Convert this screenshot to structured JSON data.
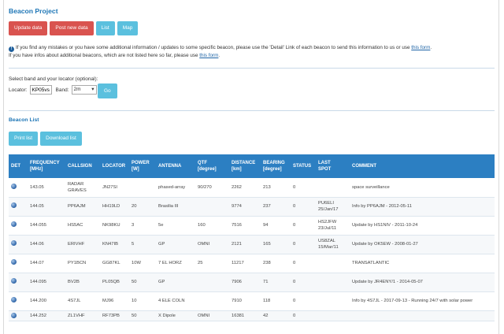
{
  "title": "Beacon Project",
  "buttons": {
    "update": "Update data",
    "post": "Post new data",
    "list": "List",
    "map": "Map"
  },
  "info": {
    "line1_pre": "If you find any mistakes or you have some additional information / updates to some specific beacon, please use the 'Detail' Link of each beacon to send this information to us or use ",
    "line1_link": "this form",
    "line1_post": ".",
    "line2_pre": "If you have infos about additional beacons, which are not listed here so far, please use ",
    "line2_link": "this form",
    "line2_post": "."
  },
  "selector": {
    "label": "Select band and your locator (optional):",
    "locator_label": "Locator:",
    "locator_value": "KP05vs",
    "band_label": "Band:",
    "band_value": "2m",
    "go": "Go"
  },
  "beacon_list": {
    "title": "Beacon List",
    "print": "Print list",
    "download": "Download list"
  },
  "table": {
    "headers": {
      "det": "DET",
      "freq": [
        "FREQUENCY",
        "[MHz]"
      ],
      "callsign": "CALLSIGN",
      "locator": "LOCATOR",
      "power": [
        "POWER",
        "[W]"
      ],
      "antenna": "ANTENNA",
      "qtf": [
        "QTF",
        "[degree]"
      ],
      "distance": [
        "DISTANCE",
        "[km]"
      ],
      "bearing": [
        "BEARING",
        "[degree]"
      ],
      "status": "STATUS",
      "lastspot": [
        "LAST",
        "SPOT"
      ],
      "comment": "COMMENT"
    },
    "rows": [
      {
        "freq": "143.05",
        "callsign": [
          "RADAR",
          "GRAVES"
        ],
        "locator": "JN27SI",
        "power": "",
        "antenna": "phased-array",
        "qtf": "90/270",
        "distance": "2262",
        "bearing": "213",
        "status": "0",
        "lastspot": [
          "",
          ""
        ],
        "comment": "space surveillance"
      },
      {
        "freq": "144.05",
        "callsign": [
          "PP6AJM",
          ""
        ],
        "locator": "HH19LD",
        "power": "20",
        "antenna": "Brasilia III",
        "qtf": "",
        "distance": "9774",
        "bearing": "237",
        "status": "0",
        "lastspot": [
          "PU6ELI",
          "25/Jan/17"
        ],
        "comment": "Info by PP6AJM - 2012-05-11"
      },
      {
        "freq": "144.055",
        "callsign": [
          "HS5AC",
          ""
        ],
        "locator": "NK98KU",
        "power": "3",
        "antenna": "5e",
        "qtf": "160",
        "distance": "7516",
        "bearing": "94",
        "status": "0",
        "lastspot": [
          "HS2JFW",
          "23/Jul/11"
        ],
        "comment": "Update by HS1NIV - 2011-10-24"
      },
      {
        "freq": "144.06",
        "callsign": [
          "ERIVHF",
          ""
        ],
        "locator": "KN47IB",
        "power": "5",
        "antenna": "GP",
        "qtf": "OMNI",
        "distance": "2121",
        "bearing": "165",
        "status": "0",
        "lastspot": [
          "US8ZAL",
          "15/Mar/11"
        ],
        "comment": "Update by OK5EW - 2008-01-27"
      },
      {
        "freq": "144.07",
        "callsign": [
          "PY1BCN",
          ""
        ],
        "locator": "GG87KL",
        "power": "10W",
        "antenna": "7 EL HORZ",
        "qtf": "25",
        "distance": "11217",
        "bearing": "238",
        "status": "0",
        "lastspot": [
          "",
          ""
        ],
        "comment": "TRANSATLANTIC"
      },
      {
        "freq": "144.095",
        "callsign": [
          "BV2B",
          ""
        ],
        "locator": "PL05QB",
        "power": "50",
        "antenna": "GP",
        "qtf": "",
        "distance": "7906",
        "bearing": "71",
        "status": "0",
        "lastspot": [
          "",
          ""
        ],
        "comment": "Update by JR4ENY/1 - 2014-05-07"
      },
      {
        "freq": "144.200",
        "callsign": [
          "4S7JL",
          ""
        ],
        "locator": "MJ96",
        "power": "10",
        "antenna": "4 ELE COLN",
        "qtf": "",
        "distance": "7910",
        "bearing": "118",
        "status": "0",
        "lastspot": [
          "",
          ""
        ],
        "comment": "Info by 4S7JL - 2017-09-13 - Running 24/7 with solar power"
      },
      {
        "freq": "144.252",
        "callsign": [
          "ZL1VHF",
          ""
        ],
        "locator": "RF73PB",
        "power": "50",
        "antenna": "X Dipole",
        "qtf": "OMNI",
        "distance": "16381",
        "bearing": "42",
        "status": "0",
        "lastspot": [
          "",
          ""
        ],
        "comment": ""
      }
    ]
  }
}
